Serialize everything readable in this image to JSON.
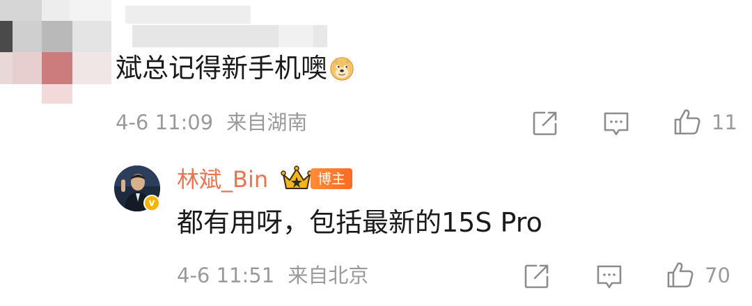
{
  "comment1": {
    "text": "斌总记得新手机噢",
    "emoji": "doge-emoji",
    "date": "4-6 11:09",
    "location": "来自湖南",
    "like_count": "11"
  },
  "comment2": {
    "username": "林斌_Bin",
    "badge": "博主",
    "text": "都有用呀，包括最新的15S Pro",
    "date": "4-6 11:51",
    "location": "来自北京",
    "like_count": "70"
  },
  "colors": {
    "username": "#eb7350",
    "meta_gray": "#9a9a9a",
    "badge_orange": "#ff6a21",
    "verified_gold": "#f6b400"
  },
  "icons": [
    "share-icon",
    "comment-icon",
    "like-icon",
    "crown-icon",
    "verified-icon"
  ]
}
